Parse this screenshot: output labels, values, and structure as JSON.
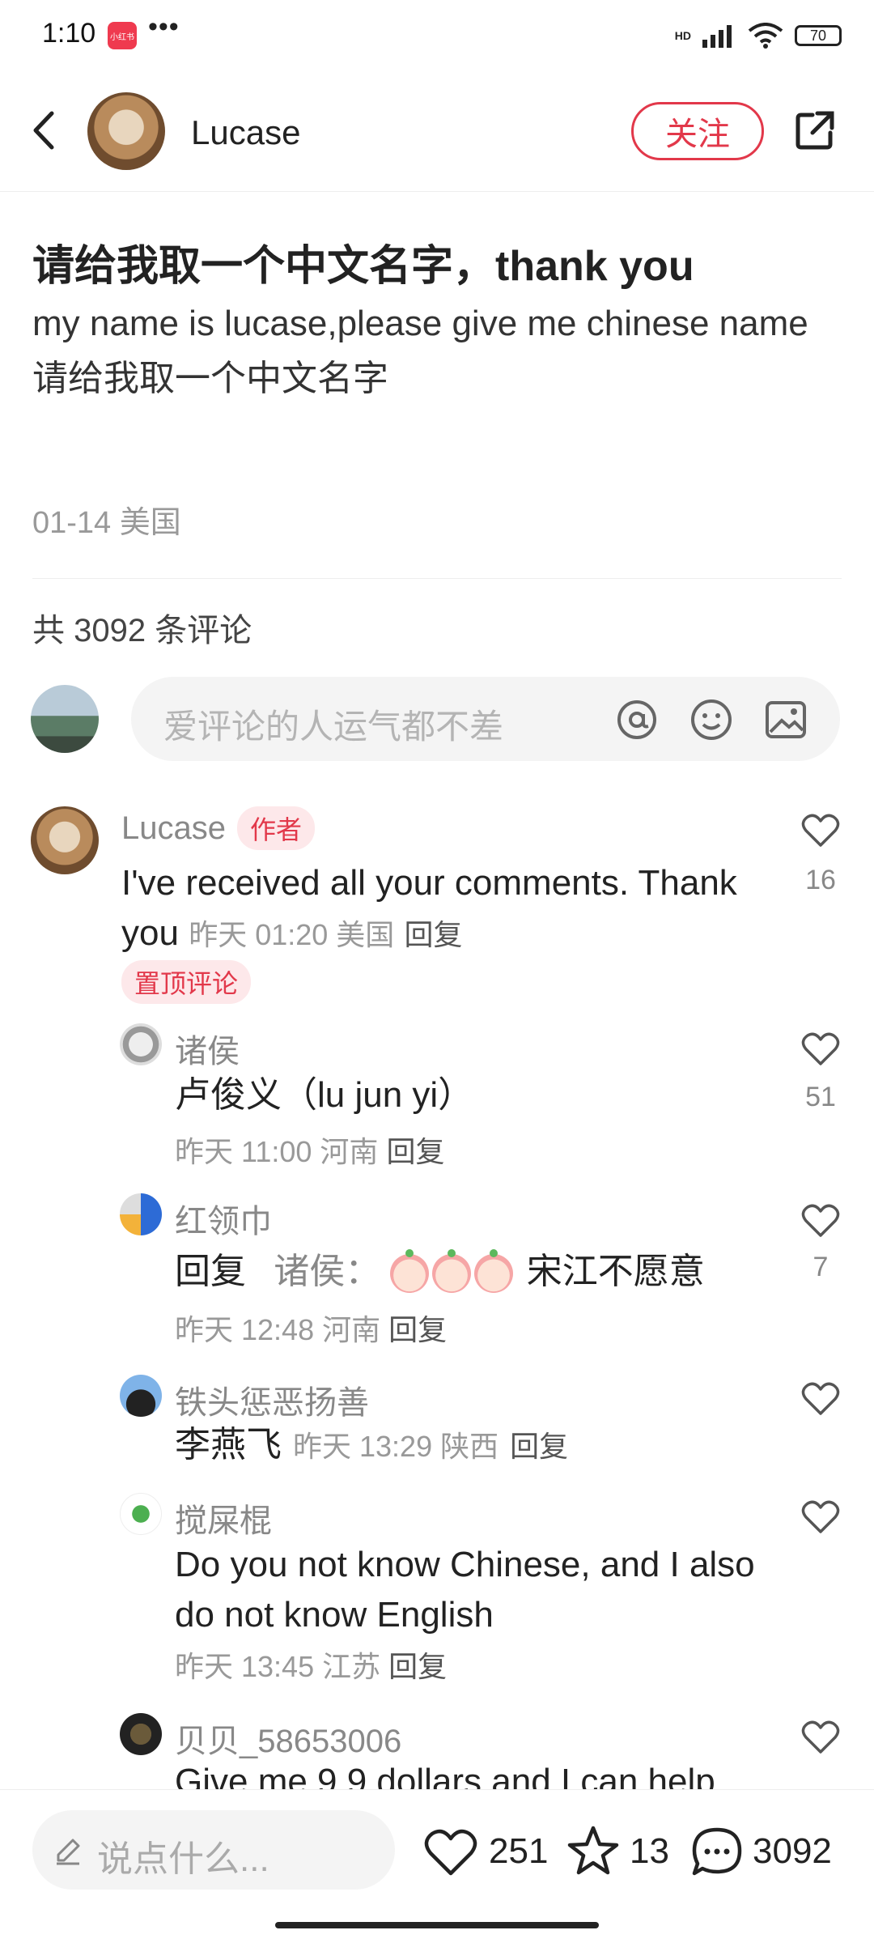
{
  "status_bar": {
    "time": "1:10",
    "app_badge": "小红书",
    "dots": "•••",
    "battery": "70",
    "hd": "HD"
  },
  "header": {
    "author": "Lucase",
    "follow_label": "关注"
  },
  "post": {
    "title": "请给我取一个中文名字，thank you",
    "body_line1": "my name is lucase,please give me chinese name",
    "body_line2": "请给我取一个中文名字",
    "meta": "01-14 美国"
  },
  "comments_header": "共 3092 条评论",
  "comment_input": {
    "placeholder": "爱评论的人运气都不差"
  },
  "comments": {
    "top": {
      "name": "Lucase",
      "tag": "作者",
      "text": "I've received all your comments. Thank you",
      "meta": "昨天 01:20 美国",
      "reply": "回复",
      "pin": "置顶评论",
      "likes": "16"
    },
    "replies": [
      {
        "name": "诸侯",
        "text": "卢俊义（lu jun yi）",
        "meta": "昨天 11:00 河南",
        "reply": "回复",
        "likes": "51"
      },
      {
        "name": "红领巾",
        "prefix": "回复",
        "target": "诸侯：",
        "text": "宋江不愿意",
        "meta": "昨天 12:48 河南",
        "reply": "回复",
        "likes": "7"
      },
      {
        "name": "铁头惩恶扬善",
        "text": "李燕飞",
        "meta": "昨天 13:29 陕西",
        "reply": "回复",
        "likes": ""
      },
      {
        "name": "搅屎棍",
        "text": "Do you not know Chinese, and I also do not know English",
        "meta": "昨天 13:45 江苏",
        "reply": "回复",
        "likes": ""
      },
      {
        "name": "贝贝_58653006",
        "text": "Give me 9.9 dollars and I can help",
        "likes": ""
      }
    ]
  },
  "bottom_bar": {
    "placeholder": "说点什么...",
    "likes": "251",
    "stars": "13",
    "comments": "3092"
  },
  "colors": {
    "accent": "#e2384a",
    "tag_bg": "#fde8ea",
    "text": "#222222",
    "muted": "#999999"
  }
}
